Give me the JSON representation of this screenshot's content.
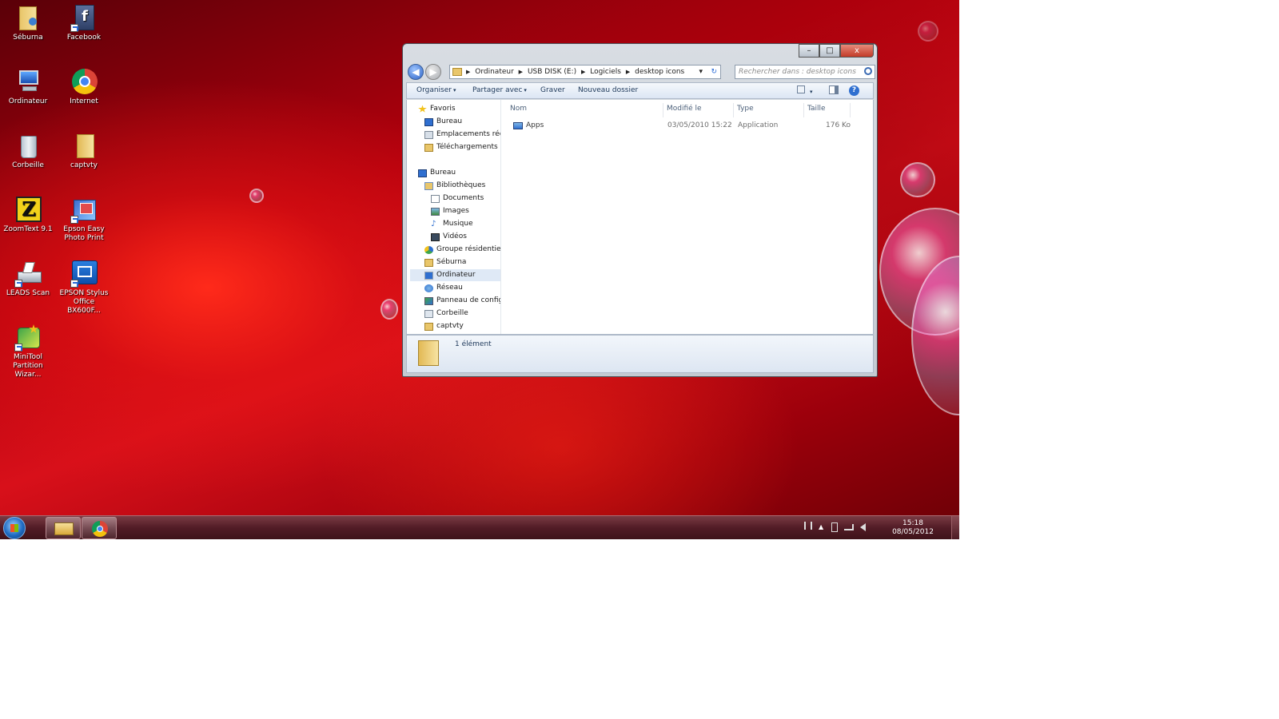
{
  "desktop": {
    "icons": [
      {
        "label": "Séburna",
        "icon": "user-folder-icon"
      },
      {
        "label": "Facebook",
        "icon": "facebook-icon"
      },
      {
        "label": "Ordinateur",
        "icon": "computer-icon"
      },
      {
        "label": "Internet",
        "icon": "chrome-icon"
      },
      {
        "label": "Corbeille",
        "icon": "recycle-bin-icon"
      },
      {
        "label": "captvty",
        "icon": "folder-icon"
      },
      {
        "label": "ZoomText 9.1",
        "icon": "zoomtext-icon"
      },
      {
        "label": "Epson Easy Photo Print",
        "icon": "epson-photo-icon"
      },
      {
        "label": "LEADS Scan",
        "icon": "scanner-icon"
      },
      {
        "label": "EPSON Stylus Office BX600F...",
        "icon": "epson-office-icon"
      },
      {
        "label": "MiniTool Partition Wizar...",
        "icon": "partition-wizard-icon"
      }
    ]
  },
  "explorer": {
    "window_controls": {
      "minimize": "–",
      "maximize": "□",
      "close": "x"
    },
    "address": {
      "crumbs": [
        "Ordinateur",
        "USB DISK (E:)",
        "Logiciels",
        "desktop icons"
      ],
      "dropdown": "▾",
      "refresh": "↻"
    },
    "search_placeholder": "Rechercher dans : desktop icons",
    "toolbar": {
      "organize": "Organiser",
      "share": "Partager avec",
      "burn": "Graver",
      "new_folder": "Nouveau dossier",
      "arrow": "▾",
      "help": "?"
    },
    "nav": {
      "favorites": "Favoris",
      "desktop": "Bureau",
      "recent": "Emplacements récents",
      "downloads": "Téléchargements",
      "desktop_root": "Bureau",
      "libraries": "Bibliothèques",
      "documents": "Documents",
      "images": "Images",
      "music": "Musique",
      "videos": "Vidéos",
      "homegroup": "Groupe résidentiel",
      "user": "Séburna",
      "computer": "Ordinateur",
      "network": "Réseau",
      "control_panel": "Panneau de configuration",
      "recycle": "Corbeille",
      "captvty": "captvty"
    },
    "columns": {
      "name": "Nom",
      "modified": "Modifié le",
      "type": "Type",
      "size": "Taille"
    },
    "files": [
      {
        "name": "Apps",
        "modified": "03/05/2010 15:22",
        "type": "Application",
        "size": "176 Ko"
      }
    ],
    "status": "1 élément"
  },
  "taskbar": {
    "clock_time": "15:18",
    "clock_date": "08/05/2012",
    "tray_show_hidden": "▲"
  },
  "colors": {
    "desktop": "#c40010",
    "taskbar": "#5a1f29",
    "window_frame": "#c9cfd7"
  }
}
